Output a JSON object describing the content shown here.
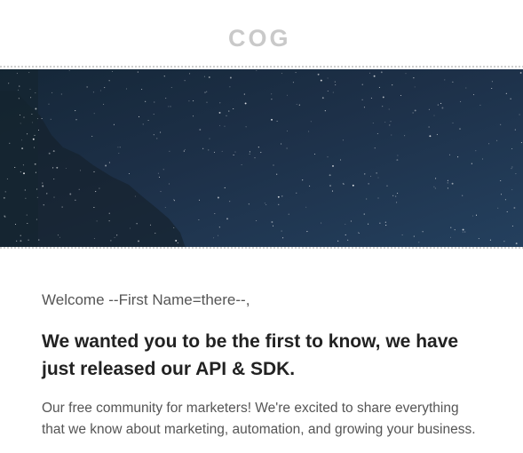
{
  "header": {
    "logo_text": "COG",
    "logo_color": "#c9c9c9"
  },
  "hero": {
    "description_icon": "starry-night-banner",
    "sky_color": "#1e3450",
    "border_color": "#c7c7c7"
  },
  "content": {
    "greeting": "Welcome --First Name=there--,",
    "headline": "We wanted you to be the first to know, we have just released our API & SDK.",
    "body": "Our free community for marketers! We're excited to share everything that we know about marketing, automation, and growing your business."
  }
}
